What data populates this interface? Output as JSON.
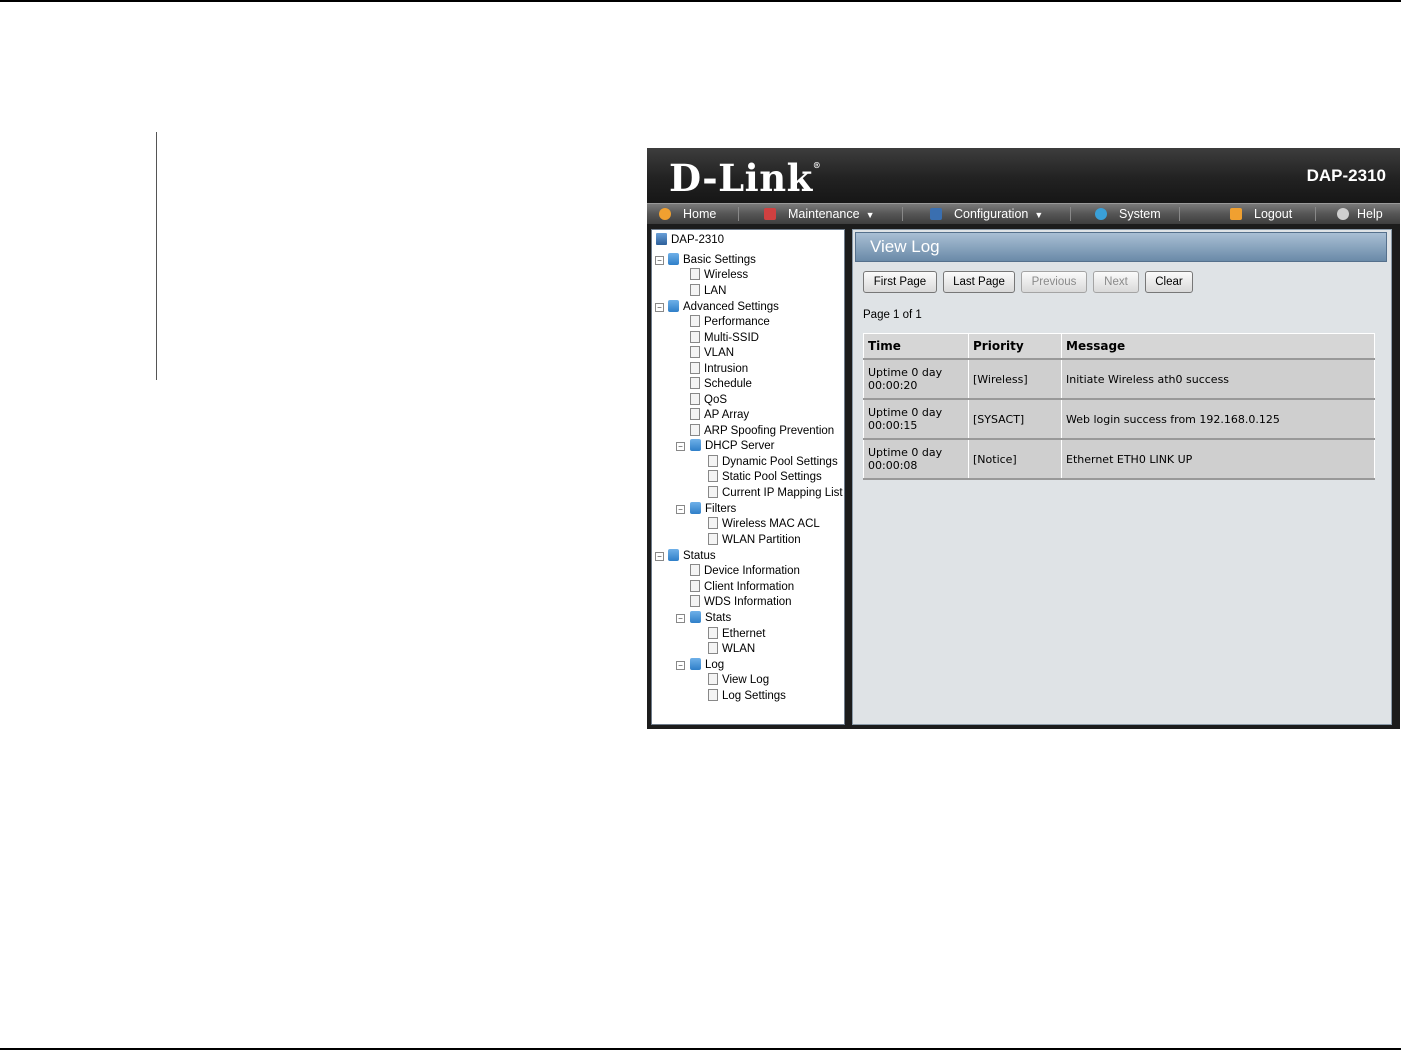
{
  "header": {
    "brand": "D-Link",
    "brand_mark": "®",
    "model": "DAP-2310"
  },
  "menu": [
    {
      "label": "Home",
      "icon": "home-icon",
      "icon_color": "#f0a030",
      "dropdown": false
    },
    {
      "label": "Maintenance",
      "icon": "tools-icon",
      "icon_color": "#d04040",
      "dropdown": true
    },
    {
      "label": "Configuration",
      "icon": "floppy-icon",
      "icon_color": "#3a6fb0",
      "dropdown": true
    },
    {
      "label": "System",
      "icon": "system-icon",
      "icon_color": "#3aa0d8",
      "dropdown": false
    },
    {
      "label": "Logout",
      "icon": "logout-icon",
      "icon_color": "#f0a030",
      "dropdown": false
    },
    {
      "label": "Help",
      "icon": "help-icon",
      "icon_color": "#cfcfcf",
      "dropdown": false
    }
  ],
  "tree": [
    {
      "label": "DAP-2310",
      "type": "root"
    },
    {
      "label": "Basic Settings",
      "type": "folder"
    },
    {
      "label": "Wireless",
      "type": "page"
    },
    {
      "label": "LAN",
      "type": "page"
    },
    {
      "label": "Advanced Settings",
      "type": "folder"
    },
    {
      "label": "Performance",
      "type": "page"
    },
    {
      "label": "Multi-SSID",
      "type": "page"
    },
    {
      "label": "VLAN",
      "type": "page"
    },
    {
      "label": "Intrusion",
      "type": "page"
    },
    {
      "label": "Schedule",
      "type": "page"
    },
    {
      "label": "QoS",
      "type": "page"
    },
    {
      "label": "AP Array",
      "type": "page"
    },
    {
      "label": "ARP Spoofing Prevention",
      "type": "page"
    },
    {
      "label": "DHCP Server",
      "type": "folder"
    },
    {
      "label": "Dynamic Pool Settings",
      "type": "page"
    },
    {
      "label": "Static Pool Settings",
      "type": "page"
    },
    {
      "label": "Current IP Mapping List",
      "type": "page"
    },
    {
      "label": "Filters",
      "type": "folder"
    },
    {
      "label": "Wireless MAC ACL",
      "type": "page"
    },
    {
      "label": "WLAN Partition",
      "type": "page"
    },
    {
      "label": "Status",
      "type": "folder"
    },
    {
      "label": "Device Information",
      "type": "page"
    },
    {
      "label": "Client Information",
      "type": "page"
    },
    {
      "label": "WDS Information",
      "type": "page"
    },
    {
      "label": "Stats",
      "type": "folder"
    },
    {
      "label": "Ethernet",
      "type": "page"
    },
    {
      "label": "WLAN",
      "type": "page"
    },
    {
      "label": "Log",
      "type": "folder"
    },
    {
      "label": "View Log",
      "type": "page"
    },
    {
      "label": "Log Settings",
      "type": "page"
    }
  ],
  "panel": {
    "title": "View Log",
    "buttons": {
      "first_page": "First Page",
      "last_page": "Last Page",
      "previous": "Previous",
      "next": "Next",
      "clear": "Clear"
    },
    "page_info": "Page 1 of 1"
  },
  "log_table": {
    "headers": [
      "Time",
      "Priority",
      "Message"
    ],
    "rows": [
      {
        "time_1": "Uptime 0 day",
        "time_2": "00:00:20",
        "priority": "[Wireless]",
        "message": "Initiate Wireless ath0 success"
      },
      {
        "time_1": "Uptime 0 day",
        "time_2": "00:00:15",
        "priority": "[SYSACT]",
        "message": "Web login success from 192.168.0.125"
      },
      {
        "time_1": "Uptime 0 day",
        "time_2": "00:00:08",
        "priority": "[Notice]",
        "message": "Ethernet ETH0 LINK UP"
      }
    ]
  }
}
